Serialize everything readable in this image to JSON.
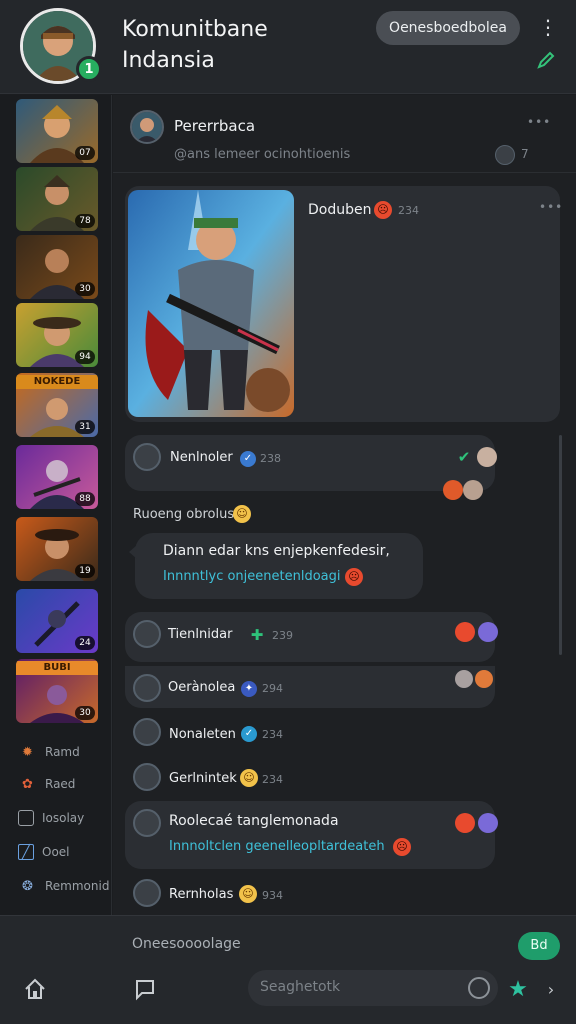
{
  "header": {
    "title": "Komunitbane Indansia",
    "chip": "Oenesboedbolea",
    "kebab": "⋮",
    "online_badge": "1"
  },
  "rail": {
    "thumbs": [
      {
        "badge": "07"
      },
      {
        "badge": "78"
      },
      {
        "badge": "30"
      },
      {
        "badge": "94"
      },
      {
        "badge": "31",
        "banner": "NOKEDE"
      },
      {
        "badge": "88"
      },
      {
        "badge": "19"
      },
      {
        "badge": "24"
      },
      {
        "badge": "30",
        "banner": "BUBI"
      }
    ],
    "links": [
      {
        "label": "Ramd",
        "icon": "star-icon"
      },
      {
        "label": "Raed",
        "icon": "flower-icon"
      },
      {
        "label": "Iosolay",
        "icon": "tag-icon"
      },
      {
        "label": "Ooel",
        "icon": "edit-icon"
      },
      {
        "label": "Remmonid",
        "icon": "globe-icon"
      }
    ]
  },
  "pinned": {
    "name": "Pererrbaca",
    "subtitle": "@ans lemeer ocinohtioenis",
    "count": "7",
    "more": "•••"
  },
  "post": {
    "author": "Doduben",
    "time": "234",
    "more": "•••"
  },
  "messages": [
    {
      "name": "Nenlnoler",
      "time": "238"
    },
    {
      "label": "Ruoeng obrolus"
    },
    {
      "line1": "Diann edar kns enjepkenfedesir,",
      "line2": "Innnntlyc onjeenetenldoagi"
    },
    {
      "name": "Tienlnidar",
      "time": "239"
    },
    {
      "name": "Oerànolea",
      "time": "294"
    },
    {
      "name": "Nonaleten",
      "time": "234"
    },
    {
      "name": "Gerlnintek",
      "time": "234"
    },
    {
      "line1": "Roolecaé tanglemonada",
      "line2": "Innnoltclen geenelleopltardeateh"
    },
    {
      "name": "Rernholas",
      "time": "934"
    }
  ],
  "composer": {
    "placeholder": "Oneesoooolage",
    "send": "Bd",
    "search_placeholder": "Seaghetotk"
  },
  "colors": {
    "accent": "#1f9d6b",
    "link": "#3fc1d9",
    "bubble": "#2b2e33"
  }
}
